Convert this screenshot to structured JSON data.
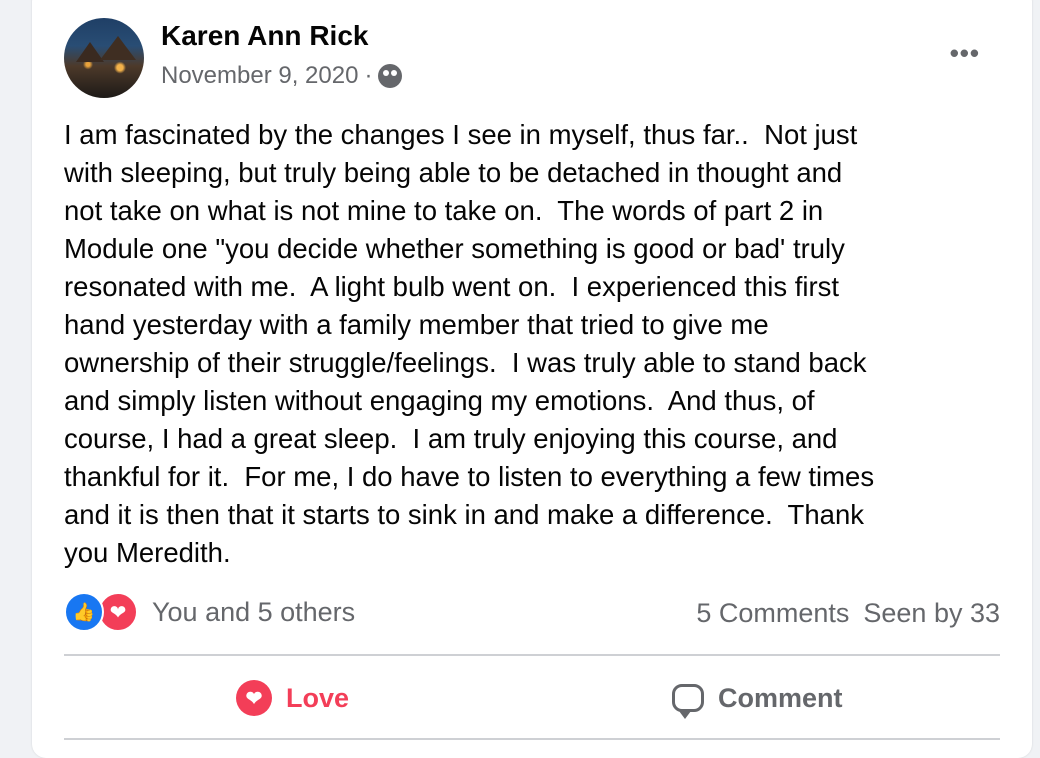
{
  "post": {
    "author": "Karen Ann Rick",
    "date": "November 9, 2020",
    "separator": "·",
    "audience_icon": "group-icon",
    "more_label": "•••",
    "text": "I am fascinated by the changes I see in myself, thus far..  Not just\nwith sleeping, but truly being able to be detached in thought and\nnot take on what is not mine to take on.  The words of part 2 in\nModule one \"you decide whether something is good or bad' truly\nresonated with me.  A light bulb went on.  I experienced this first\nhand yesterday with a family member that tried to give me\nownership of their struggle/feelings.  I was truly able to stand back\nand simply listen without engaging my emotions.  And thus, of\ncourse, I had a great sleep.  I am truly enjoying this course, and\nthankful for it.  For me, I do have to listen to everything a few times\nand it is then that it starts to sink in and make a difference.  Thank\nyou Meredith."
  },
  "reactions": {
    "like_glyph": "👍",
    "love_glyph": "❤",
    "summary": "You and 5 others",
    "comments": "5 Comments",
    "seen": "Seen by 33"
  },
  "actions": {
    "love_label": "Love",
    "love_glyph": "❤",
    "comment_label": "Comment"
  },
  "colors": {
    "love": "#f33e58",
    "like": "#1877f2",
    "secondary_text": "#65676b"
  }
}
